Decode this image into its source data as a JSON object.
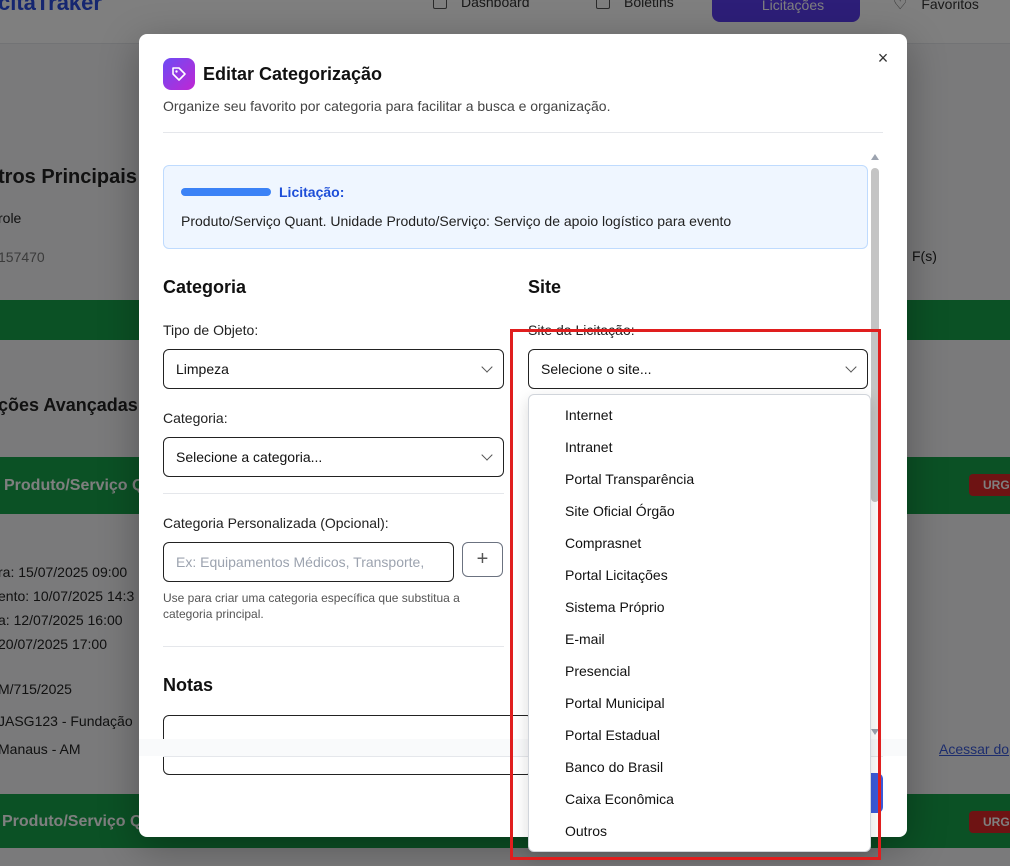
{
  "background": {
    "brand": "citaTraker",
    "nav": [
      "Dashboard",
      "Boletins",
      "Licitações",
      "Favoritos"
    ],
    "section_main": "tros Principais",
    "col_role": "role",
    "id_value": "157470",
    "col_right": "F(s)",
    "section_adv": "ções Avançadas",
    "card_title": "Produto/Serviço Q",
    "urgent": "URG",
    "dates": [
      "ra: 15/07/2025 09:00",
      "ento: 10/07/2025 14:3",
      "a: 12/07/2025 16:00",
      "20/07/2025 17:00"
    ],
    "ref": "M/715/2025",
    "org": "JASG123 - Fundação",
    "city": "Manaus - AM",
    "link": "Acessar do"
  },
  "modal": {
    "title": "Editar Categorização",
    "subtitle": "Organize seu favorito por categoria para facilitar a busca e organização.",
    "close_label": "×",
    "licitacao_label": "Licitação:",
    "licitacao_desc": "Produto/Serviço Quant. Unidade Produto/Serviço: Serviço de apoio logístico para evento",
    "categoria": {
      "heading": "Categoria",
      "tipo_label": "Tipo de Objeto:",
      "tipo_value": "Limpeza",
      "categoria_label": "Categoria:",
      "categoria_value": "Selecione a categoria...",
      "custom_label": "Categoria Personalizada (Opcional):",
      "custom_placeholder": "Ex: Equipamentos Médicos, Transporte,",
      "add_label": "+",
      "hint": "Use para criar uma categoria específica que substitua a categoria principal."
    },
    "site": {
      "heading": "Site",
      "site_label": "Site da Licitação:",
      "site_value": "Selecione o site...",
      "options": [
        "Internet",
        "Intranet",
        "Portal Transparência",
        "Site Oficial Órgão",
        "Comprasnet",
        "Portal Licitações",
        "Sistema Próprio",
        "E-mail",
        "Presencial",
        "Portal Municipal",
        "Portal Estadual",
        "Banco do Brasil",
        "Caixa Econômica",
        "Outros"
      ]
    },
    "notes_heading": "Notas"
  },
  "colors": {
    "accent": "#5b3df0",
    "highlight": "#e01e1e",
    "info_bg": "#eff6ff"
  }
}
